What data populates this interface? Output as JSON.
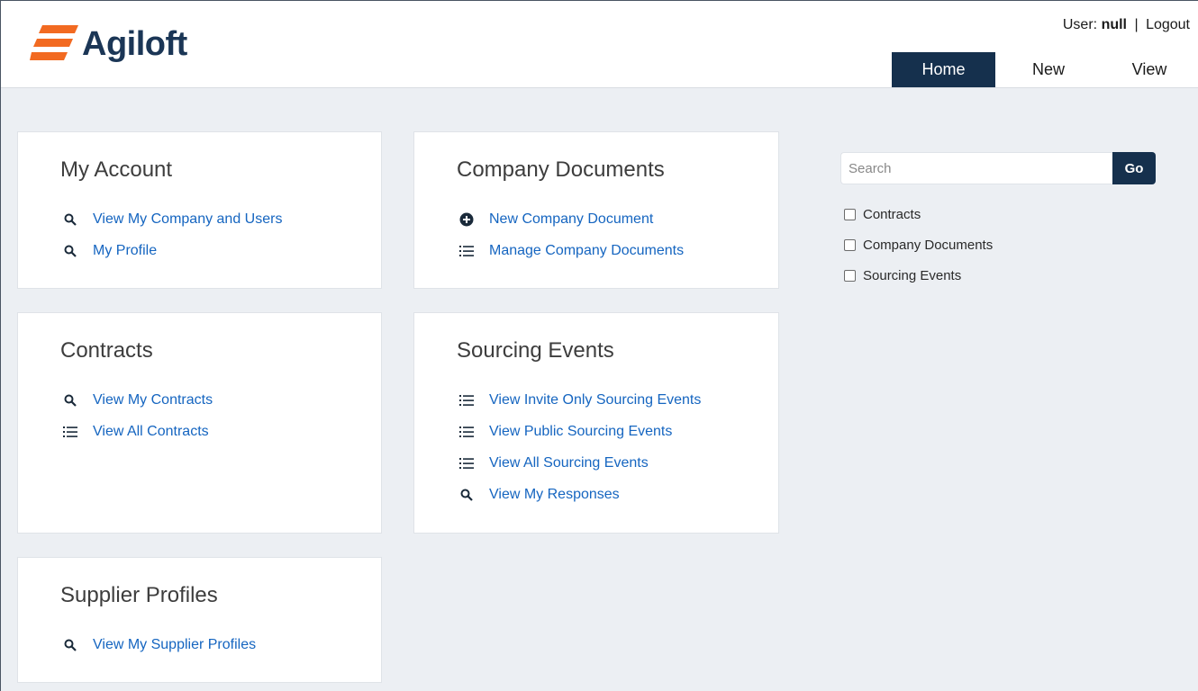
{
  "brand": {
    "name": "Agiloft",
    "color": "#1b3656",
    "accent": "#f26a21"
  },
  "userbar": {
    "label": "User:",
    "user": "null",
    "separator": "|",
    "logout": "Logout"
  },
  "nav": {
    "home": "Home",
    "new": "New",
    "view": "View",
    "active_color": "#15304d"
  },
  "cards": {
    "my_account": {
      "title": "My Account",
      "links": [
        {
          "icon": "search-icon",
          "label": "View My Company and Users"
        },
        {
          "icon": "search-icon",
          "label": "My Profile"
        }
      ]
    },
    "company_documents": {
      "title": "Company Documents",
      "links": [
        {
          "icon": "plus-circle-icon",
          "label": "New Company Document"
        },
        {
          "icon": "list-icon",
          "label": "Manage Company Documents"
        }
      ]
    },
    "contracts": {
      "title": "Contracts",
      "links": [
        {
          "icon": "search-icon",
          "label": "View My Contracts"
        },
        {
          "icon": "list-icon",
          "label": "View All Contracts"
        }
      ]
    },
    "sourcing_events": {
      "title": "Sourcing Events",
      "links": [
        {
          "icon": "list-icon",
          "label": "View Invite Only Sourcing Events"
        },
        {
          "icon": "list-icon",
          "label": "View Public Sourcing Events"
        },
        {
          "icon": "list-icon",
          "label": "View All Sourcing Events"
        },
        {
          "icon": "search-icon",
          "label": "View My Responses"
        }
      ]
    },
    "supplier_profiles": {
      "title": "Supplier Profiles",
      "links": [
        {
          "icon": "search-icon",
          "label": "View My Supplier Profiles"
        }
      ]
    }
  },
  "search": {
    "placeholder": "Search",
    "value": "",
    "button": "Go",
    "filters": [
      "Contracts",
      "Company Documents",
      "Sourcing Events"
    ]
  },
  "colors": {
    "link": "#1565c0",
    "background": "#eceff3"
  }
}
